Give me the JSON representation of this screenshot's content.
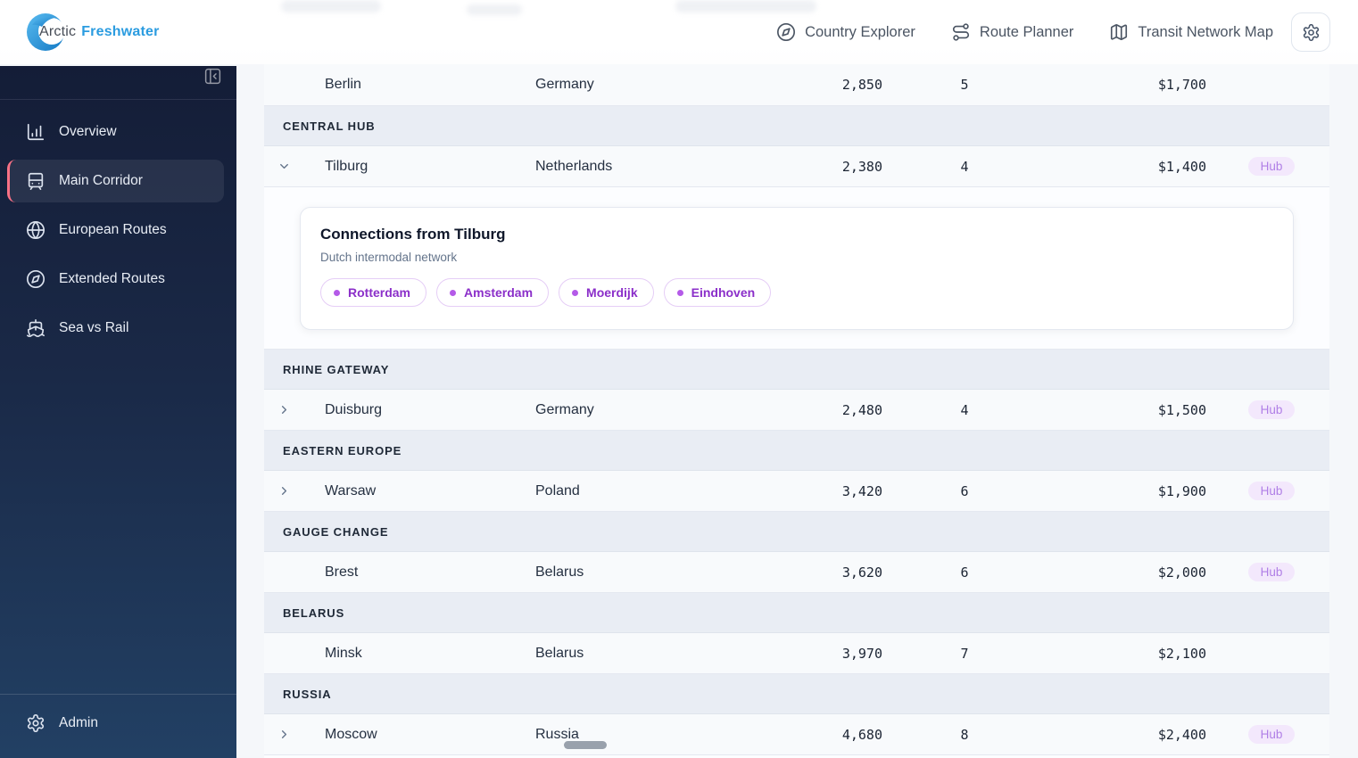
{
  "brand": {
    "name_primary": "Arctic",
    "name_secondary": "Freshwater"
  },
  "header": {
    "nav": [
      {
        "label": "Country Explorer",
        "icon": "compass-icon"
      },
      {
        "label": "Route Planner",
        "icon": "route-icon"
      },
      {
        "label": "Transit Network Map",
        "icon": "map-icon"
      }
    ],
    "settings_icon": "gear-icon"
  },
  "sidebar": {
    "collapse_icon": "panel-collapse-icon",
    "items": [
      {
        "label": "Overview",
        "icon": "bar-chart-icon",
        "active": false
      },
      {
        "label": "Main Corridor",
        "icon": "tram-icon",
        "active": true
      },
      {
        "label": "European Routes",
        "icon": "globe-icon",
        "active": false
      },
      {
        "label": "Extended Routes",
        "icon": "compass-icon",
        "active": false
      },
      {
        "label": "Sea vs Rail",
        "icon": "ship-icon",
        "active": false
      }
    ],
    "admin": {
      "label": "Admin",
      "icon": "gear-icon"
    }
  },
  "table": {
    "hub_badge_label": "Hub",
    "rows": [
      {
        "type": "data",
        "city": "Berlin",
        "country": "Germany",
        "distance": "2,850",
        "stops": "5",
        "price": "$1,700",
        "hub": false,
        "chevron": "none",
        "expanded": false
      },
      {
        "type": "section",
        "label": "CENTRAL HUB"
      },
      {
        "type": "data",
        "city": "Tilburg",
        "country": "Netherlands",
        "distance": "2,380",
        "stops": "4",
        "price": "$1,400",
        "hub": true,
        "chevron": "down",
        "expanded": true
      },
      {
        "type": "expansion",
        "title": "Connections from Tilburg",
        "subtitle": "Dutch intermodal network",
        "connections": [
          "Rotterdam",
          "Amsterdam",
          "Moerdijk",
          "Eindhoven"
        ]
      },
      {
        "type": "section",
        "label": "RHINE GATEWAY"
      },
      {
        "type": "data",
        "city": "Duisburg",
        "country": "Germany",
        "distance": "2,480",
        "stops": "4",
        "price": "$1,500",
        "hub": true,
        "chevron": "right",
        "expanded": false
      },
      {
        "type": "section",
        "label": "EASTERN EUROPE"
      },
      {
        "type": "data",
        "city": "Warsaw",
        "country": "Poland",
        "distance": "3,420",
        "stops": "6",
        "price": "$1,900",
        "hub": true,
        "chevron": "right",
        "expanded": false
      },
      {
        "type": "section",
        "label": "GAUGE CHANGE"
      },
      {
        "type": "data",
        "city": "Brest",
        "country": "Belarus",
        "distance": "3,620",
        "stops": "6",
        "price": "$2,000",
        "hub": true,
        "chevron": "none",
        "expanded": false
      },
      {
        "type": "section",
        "label": "BELARUS"
      },
      {
        "type": "data",
        "city": "Minsk",
        "country": "Belarus",
        "distance": "3,970",
        "stops": "7",
        "price": "$2,100",
        "hub": false,
        "chevron": "none",
        "expanded": false
      },
      {
        "type": "section",
        "label": "RUSSIA"
      },
      {
        "type": "data",
        "city": "Moscow",
        "country": "Russia",
        "distance": "4,680",
        "stops": "8",
        "price": "$2,400",
        "hub": true,
        "chevron": "right",
        "expanded": false
      }
    ]
  },
  "colors": {
    "accent_active": "#f87185",
    "brand_blue": "#2b9ce0",
    "hub_badge_bg": "#f3e8fc",
    "hub_badge_text": "#b07fe6",
    "chip_text": "#8b2fc9",
    "chip_border": "#e5cdf6",
    "sidebar_top": "#141d37",
    "sidebar_bottom": "#224064"
  }
}
